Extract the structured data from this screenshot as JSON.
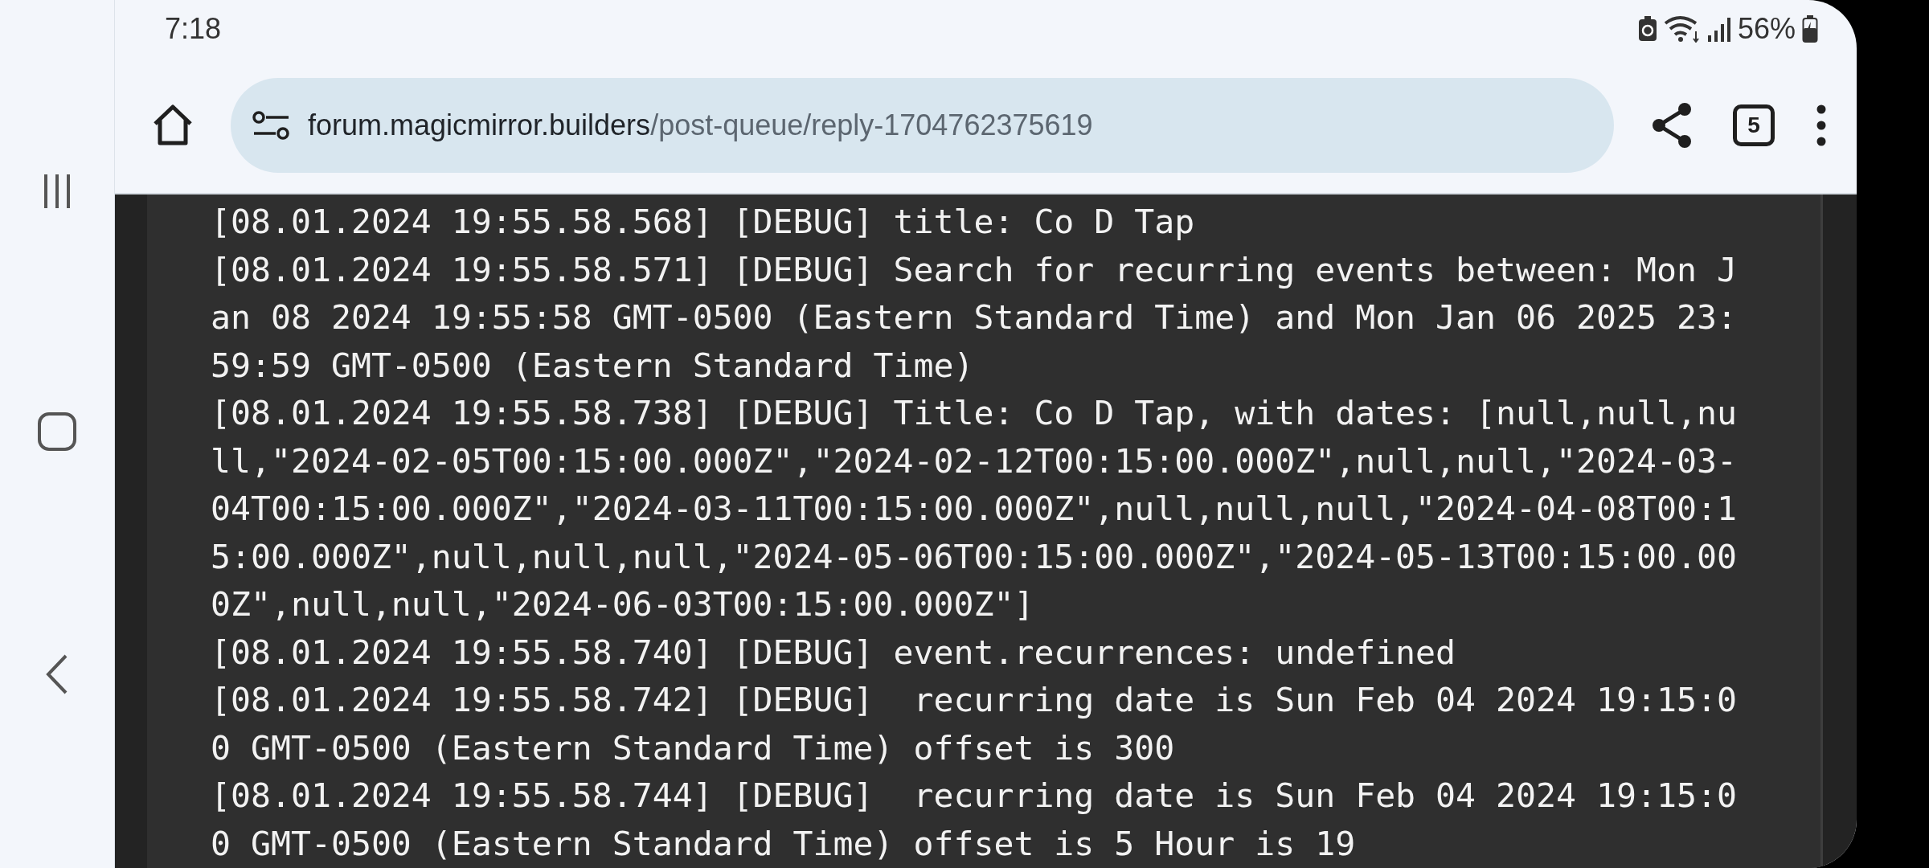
{
  "status_bar": {
    "time": "7:18",
    "battery": "56%"
  },
  "browser": {
    "url_host": "forum.magicmirror.builders",
    "url_path": "/post-queue/reply-1704762375619",
    "tab_count": "5"
  },
  "log": {
    "entries": [
      "[08.01.2024 19:55.58.568] [DEBUG] title: Co D Tap",
      "[08.01.2024 19:55.58.571] [DEBUG] Search for recurring events between: Mon Jan 08 2024 19:55:58 GMT-0500 (Eastern Standard Time) and Mon Jan 06 2025 23:59:59 GMT-0500 (Eastern Standard Time)",
      "[08.01.2024 19:55.58.738] [DEBUG] Title: Co D Tap, with dates: [null,null,null,\"2024-02-05T00:15:00.000Z\",\"2024-02-12T00:15:00.000Z\",null,null,\"2024-03-04T00:15:00.000Z\",\"2024-03-11T00:15:00.000Z\",null,null,null,\"2024-04-08T00:15:00.000Z\",null,null,null,\"2024-05-06T00:15:00.000Z\",\"2024-05-13T00:15:00.000Z\",null,null,\"2024-06-03T00:15:00.000Z\"]",
      "[08.01.2024 19:55.58.740] [DEBUG] event.recurrences: undefined",
      "[08.01.2024 19:55.58.742] [DEBUG]  recurring date is Sun Feb 04 2024 19:15:00 GMT-0500 (Eastern Standard Time) offset is 300",
      "[08.01.2024 19:55.58.744] [DEBUG]  recurring date is Sun Feb 04 2024 19:15:00 GMT-0500 (Eastern Standard Time) offset is 5 Hour is 19"
    ]
  }
}
